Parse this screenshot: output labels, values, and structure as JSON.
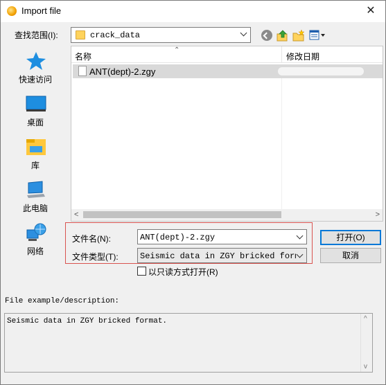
{
  "window": {
    "title": "Import file",
    "close_glyph": "✕"
  },
  "lookin": {
    "label": "查找范围(I):",
    "value": "crack_data"
  },
  "places": [
    {
      "label": "快速访问",
      "icon": "star-icon"
    },
    {
      "label": "桌面",
      "icon": "desktop-icon"
    },
    {
      "label": "库",
      "icon": "library-icon"
    },
    {
      "label": "此电脑",
      "icon": "computer-icon"
    },
    {
      "label": "网络",
      "icon": "network-icon"
    }
  ],
  "filelist": {
    "columns": [
      "名称",
      "修改日期"
    ],
    "rows": [
      {
        "name": "ANT(dept)-2.zgy"
      }
    ]
  },
  "filename": {
    "label": "文件名(N):",
    "value": "ANT(dept)-2.zgy"
  },
  "filetype": {
    "label": "文件类型(T):",
    "value": "Seismic data in ZGY bricked format (*"
  },
  "buttons": {
    "open": "打开(O)",
    "cancel": "取消"
  },
  "readonly": {
    "label": "以只读方式打开(R)"
  },
  "description": {
    "label": "File example/description:",
    "text": "Seismic data in ZGY bricked format."
  },
  "colors": {
    "accent": "#0078d7",
    "highlight": "#d9534f",
    "selection": "#d9d9d9"
  }
}
